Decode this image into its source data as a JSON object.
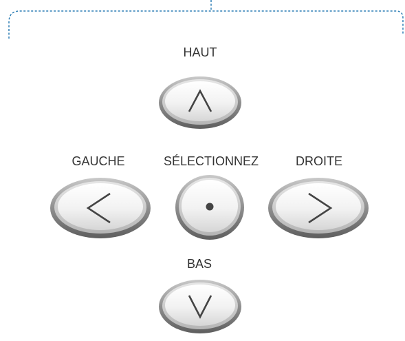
{
  "labels": {
    "up": "HAUT",
    "left": "GAUCHE",
    "select": "SÉLECTIONNEZ",
    "right": "DROITE",
    "down": "BAS"
  },
  "icons": {
    "up": "chevron-up-icon",
    "left": "chevron-left-icon",
    "select": "dot-icon",
    "right": "chevron-right-icon",
    "down": "chevron-down-icon"
  },
  "colors": {
    "bracket": "#2e7fb5",
    "label": "#333333",
    "glyph": "#444444",
    "button_rim": "#9a9a9a"
  }
}
